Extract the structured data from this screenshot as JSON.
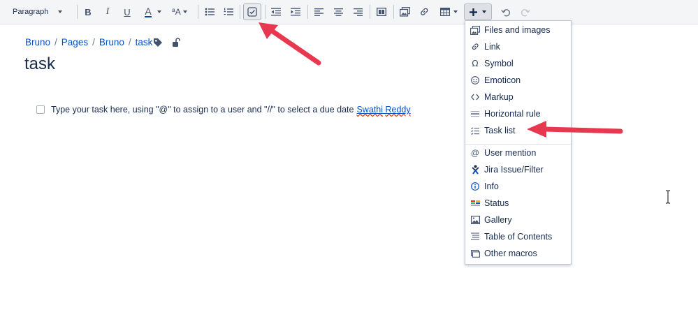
{
  "toolbar": {
    "paragraph_label": "Paragraph",
    "bold_label": "B",
    "italic_label": "I",
    "underline_label": "U",
    "text_color_label": "A",
    "text_color_accent": "#0747a6",
    "text_size_label": "ªA"
  },
  "breadcrumb": {
    "items": [
      "Bruno",
      "Pages",
      "Bruno",
      "task"
    ],
    "separator": "/"
  },
  "page": {
    "title": "task"
  },
  "task": {
    "text": "Type your task here, using \"@\" to assign to a user and \"//\" to select a due date",
    "mention_first": "Swathi",
    "mention_last": "Reddy"
  },
  "insert_menu": {
    "items": [
      {
        "label": "Files and images",
        "icon": "image-icon"
      },
      {
        "label": "Link",
        "icon": "link-icon"
      },
      {
        "label": "Symbol",
        "icon": "omega-icon"
      },
      {
        "label": "Emoticon",
        "icon": "smiley-icon"
      },
      {
        "label": "Markup",
        "icon": "code-icon"
      },
      {
        "label": "Horizontal rule",
        "icon": "horizontal-rule-icon"
      },
      {
        "label": "Task list",
        "icon": "task-list-icon"
      },
      {
        "label": "User mention",
        "icon": "at-icon"
      },
      {
        "label": "Jira Issue/Filter",
        "icon": "jira-icon"
      },
      {
        "label": "Info",
        "icon": "info-icon"
      },
      {
        "label": "Status",
        "icon": "status-icon"
      },
      {
        "label": "Gallery",
        "icon": "gallery-icon"
      },
      {
        "label": "Table of Contents",
        "icon": "toc-icon"
      },
      {
        "label": "Other macros",
        "icon": "macro-icon"
      }
    ]
  },
  "colors": {
    "link": "#0052cc",
    "annotation_arrow": "#e8384f",
    "spellcheck": "#de350b"
  }
}
